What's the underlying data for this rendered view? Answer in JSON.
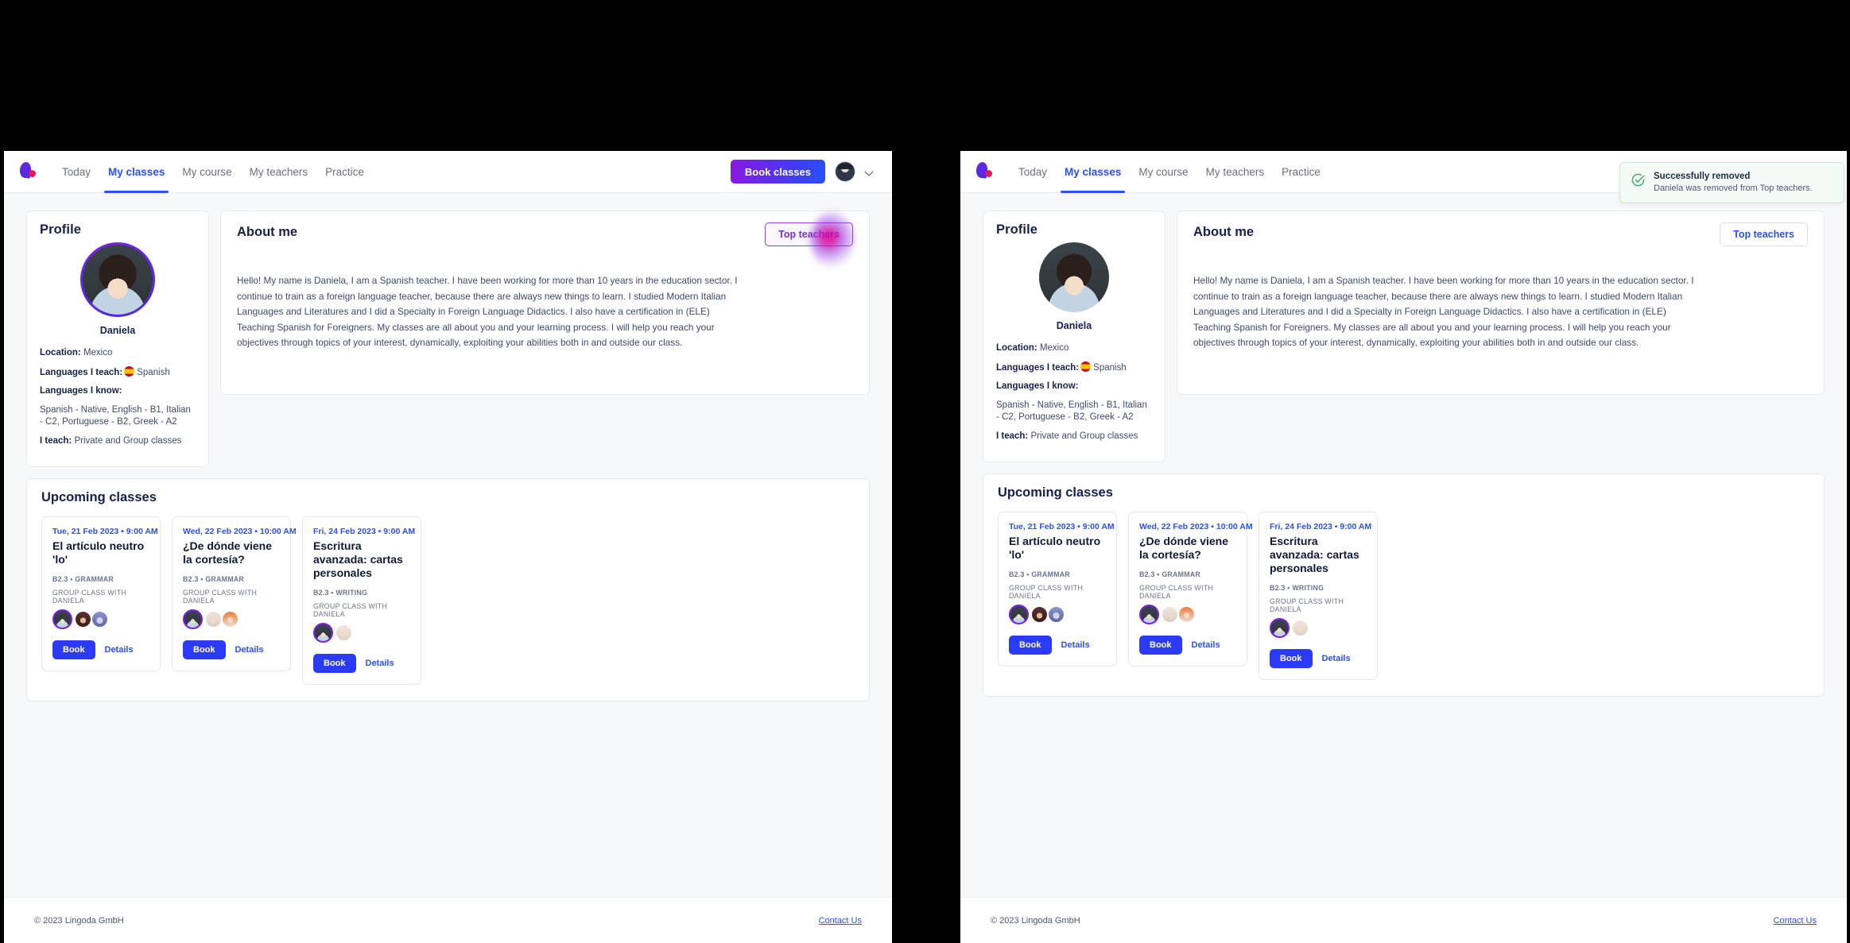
{
  "nav": {
    "items": [
      {
        "label": "Today",
        "active": false
      },
      {
        "label": "My classes",
        "active": true
      },
      {
        "label": "My course",
        "active": false
      },
      {
        "label": "My teachers",
        "active": false
      },
      {
        "label": "Practice",
        "active": false
      }
    ],
    "book_classes_label": "Book classes"
  },
  "profile": {
    "title": "Profile",
    "name": "Daniela",
    "location_label": "Location:",
    "location_value": "Mexico",
    "teach_label": "Languages I teach:",
    "teach_value": "Spanish",
    "know_label": "Languages I know:",
    "know_value": "Spanish - Native, English - B1, Italian - C2, Portuguese - B2, Greek - A2",
    "iteach_label": "I teach:",
    "iteach_value": "Private and Group classes"
  },
  "about": {
    "title": "About me",
    "top_teachers_label": "Top teachers",
    "body": "Hello! My name is Daniela, I am a Spanish teacher. I have been working for more than 10 years in the education sector. I continue to train as a foreign language teacher, because there are always new things to learn. I studied Modern Italian Languages and Literatures and I did a Specialty in Foreign Language Didactics. I also have a certification in (ELE) Teaching Spanish for Foreigners. My classes are all about you and your learning process. I will help you reach your objectives through topics of your interest, dynamically, exploiting your abilities both in and outside our class."
  },
  "upcoming": {
    "title": "Upcoming classes",
    "book_label": "Book",
    "details_label": "Details",
    "classes": [
      {
        "date": "Tue, 21 Feb 2023 • 9:00 AM",
        "title": "El artículo neutro 'lo'",
        "level": "B2.3 •",
        "category": "GRAMMAR",
        "group": "GROUP CLASS WITH DANIELA",
        "attendees": 3
      },
      {
        "date": "Wed, 22 Feb 2023 • 10:00 AM",
        "title": "¿De dónde viene la cortesía?",
        "level": "B2.3 •",
        "category": "GRAMMAR",
        "group": "GROUP CLASS WITH DANIELA",
        "attendees": 3
      },
      {
        "date": "Fri, 24 Feb 2023 • 9:00 AM",
        "title": "Escritura avanzada: cartas personales",
        "level": "B2.3 •",
        "category": "WRITING",
        "group": "GROUP CLASS WITH DANIELA",
        "attendees": 2
      }
    ]
  },
  "footer": {
    "copyright": "© 2023 Lingoda GmbH",
    "contact": "Contact Us"
  },
  "toast": {
    "title": "Successfully removed",
    "message": "Daniela was removed from Top teachers.",
    "icon": "check-circle-icon",
    "accent": "#49b06a"
  },
  "colors": {
    "brand_blue": "#2b50f5",
    "brand_purple": "#7b1fe0",
    "heading": "#16224d",
    "page_bg": "#f7f8fa"
  }
}
